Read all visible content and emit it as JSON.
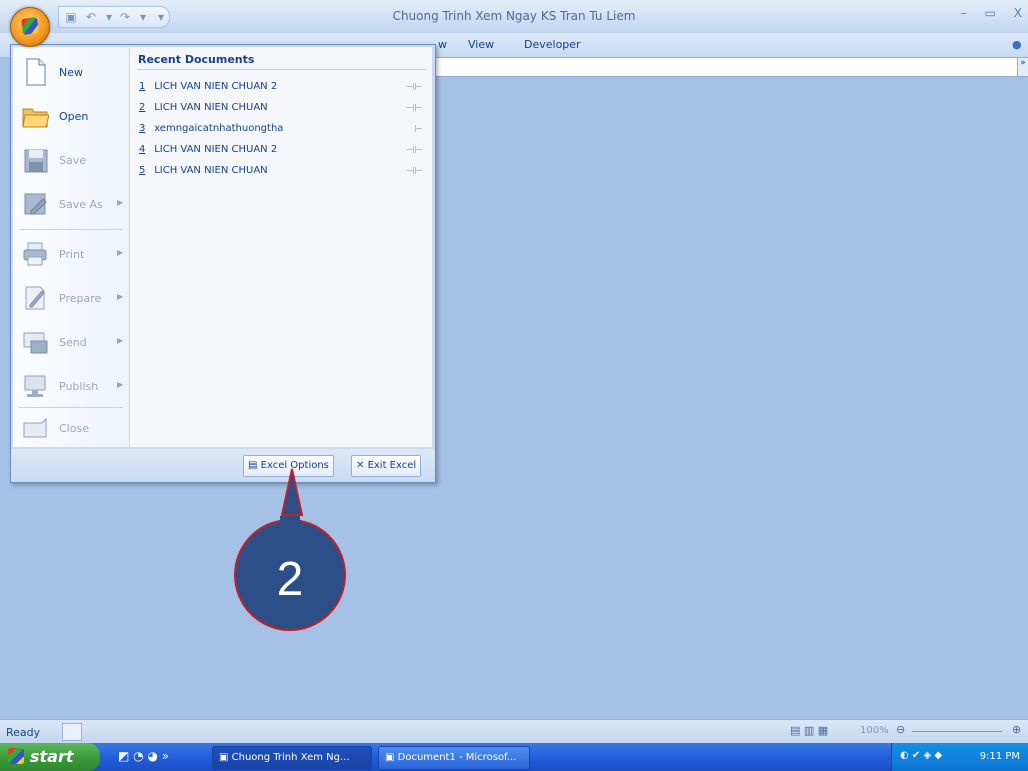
{
  "window": {
    "title": "Chuong Trinh Xem Ngay KS Tran Tu Liem",
    "controls": [
      "–",
      "▭",
      "X"
    ]
  },
  "ribbon": {
    "tabs_visible": [
      "w",
      "View",
      "Developer"
    ],
    "help_icon": "help-icon"
  },
  "office_menu": {
    "items": [
      {
        "label": "New",
        "icon": "new-document-icon",
        "enabled": true,
        "submenu": false
      },
      {
        "label": "Open",
        "icon": "open-folder-icon",
        "enabled": true,
        "submenu": false
      },
      {
        "label": "Save",
        "icon": "save-disk-icon",
        "enabled": false,
        "submenu": false
      },
      {
        "label": "Save As",
        "icon": "save-as-icon",
        "enabled": false,
        "submenu": true
      },
      {
        "label": "Print",
        "icon": "printer-icon",
        "enabled": false,
        "submenu": true
      },
      {
        "label": "Prepare",
        "icon": "prepare-icon",
        "enabled": false,
        "submenu": true
      },
      {
        "label": "Send",
        "icon": "send-icon",
        "enabled": false,
        "submenu": true
      },
      {
        "label": "Publish",
        "icon": "publish-icon",
        "enabled": false,
        "submenu": true
      },
      {
        "label": "Close",
        "icon": "close-folder-icon",
        "enabled": false,
        "submenu": false
      }
    ],
    "recent_title": "Recent Documents",
    "recent_docs": [
      {
        "num": "1",
        "name": "LICH VAN NIEN CHUAN 2"
      },
      {
        "num": "2",
        "name": "LICH VAN NIEN CHUAN"
      },
      {
        "num": "3",
        "name": "xemngaicatnhathuongtha"
      },
      {
        "num": "4",
        "name": "LICH VAN NIEN CHUAN 2"
      },
      {
        "num": "5",
        "name": "LICH VAN NIEN CHUAN"
      }
    ],
    "options_label": "Excel Options",
    "exit_label": "Exit Excel"
  },
  "callout": {
    "number": "2",
    "color": "#2b4f86",
    "border": "#c0202a"
  },
  "statusbar": {
    "ready": "Ready",
    "zoom": "100%"
  },
  "taskbar": {
    "start_label": "start",
    "tasks": [
      {
        "label": "Chuong Trinh Xem Ng...",
        "active": true
      },
      {
        "label": "Document1 - Microsof...",
        "active": false
      }
    ],
    "clock": "9:11 PM"
  }
}
